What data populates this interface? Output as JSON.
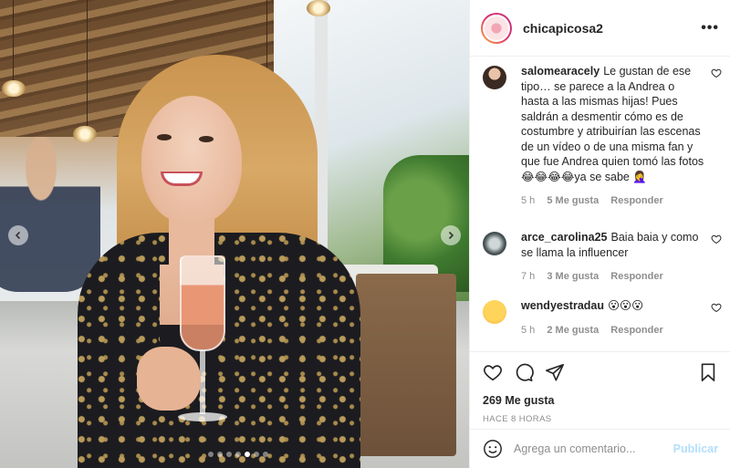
{
  "post": {
    "username": "chicapicosa2",
    "more_label": "•••",
    "likes_label": "269 Me gusta",
    "time_label": "HACE 8 HORAS",
    "carousel": {
      "total": 7,
      "active": 4
    }
  },
  "comments": [
    {
      "username": "salomearacely",
      "text": "Le gustan de ese tipo… se parece a la Andrea o hasta a las mismas hijas! Pues saldrán a desmentir cómo es de costumbre y atribuirían las escenas de un vídeo o de una misma fan y que fue Andrea quien tomó las fotos 😂😂😂😂ya se sabe 🤦‍♀️",
      "time": "5 h",
      "likes": "5 Me gusta",
      "reply": "Responder"
    },
    {
      "username": "arce_carolina25",
      "text": "Baia baia y como se llama la influencer",
      "time": "7 h",
      "likes": "3 Me gusta",
      "reply": "Responder"
    },
    {
      "username": "wendyestradau",
      "text": "😮😮😮",
      "time": "5 h",
      "likes": "2 Me gusta",
      "reply": "Responder"
    }
  ],
  "composer": {
    "placeholder": "Agrega un comentario...",
    "publish_label": "Publicar"
  },
  "colors": {
    "text": "#262626",
    "muted": "#8e8e8e",
    "publish_disabled": "#b2dffc",
    "divider": "#efefef"
  },
  "icons": [
    "chevron-left-icon",
    "chevron-right-icon",
    "more-icon",
    "heart-icon",
    "comment-icon",
    "share-icon",
    "bookmark-icon",
    "emoji-icon"
  ]
}
